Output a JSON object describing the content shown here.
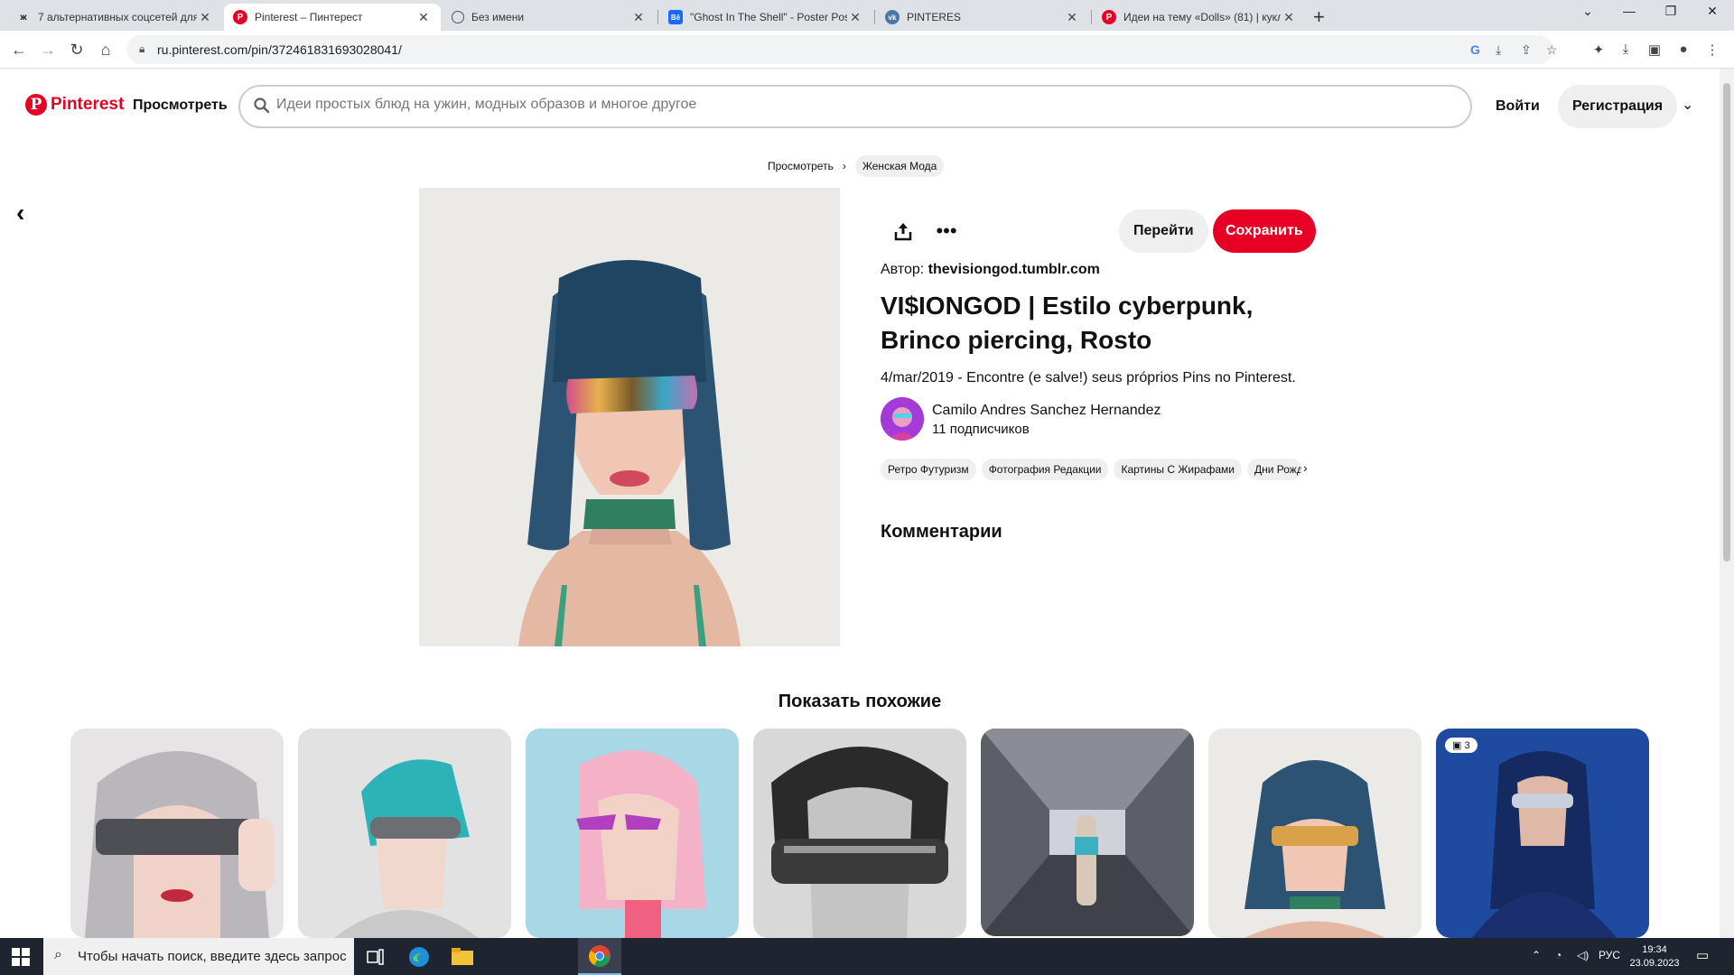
{
  "browser": {
    "tabs": [
      {
        "title": "7 альтернативных соцсетей для",
        "icon": "ж"
      },
      {
        "title": "Pinterest – Пинтерест",
        "icon": "P"
      },
      {
        "title": "Без имени",
        "icon": "globe"
      },
      {
        "title": "\"Ghost In The Shell\" - Poster Pos",
        "icon": "Bē"
      },
      {
        "title": "PINTERES",
        "icon": "vk"
      },
      {
        "title": "Идеи на тему «Dolls» (81) | кукл",
        "icon": "P"
      }
    ],
    "url": "ru.pinterest.com/pin/372461831693028041/"
  },
  "header": {
    "logo_text": "Pinterest",
    "explore": "Просмотреть",
    "search_placeholder": "Идеи простых блюд на ужин, модных образов и многое другое",
    "login": "Войти",
    "signup": "Регистрация"
  },
  "breadcrumb": {
    "root": "Просмотреть",
    "current": "Женская Мода"
  },
  "pin": {
    "goto_label": "Перейти",
    "save_label": "Сохранить",
    "author_label": "Автор:",
    "author_site": "thevisiongod.tumblr.com",
    "title": "VI$IONGOD | Estilo cyberpunk, Brinco piercing, Rosto",
    "description": "4/mar/2019 - Encontre (e salve!) seus próprios Pins no Pinterest.",
    "user_name": "Camilo Andres Sanchez Hernandez",
    "followers": "11 подписчиков",
    "tags": [
      "Ретро Футуризм",
      "Фотография Редакции",
      "Картины С Жирафами",
      "Дни Рождения"
    ],
    "comments_title": "Комментарии"
  },
  "more": {
    "title": "Показать похожие",
    "badge": "3"
  },
  "taskbar": {
    "search_text": "Чтобы начать поиск, введите здесь запрос",
    "lang": "РУС",
    "time": "19:34",
    "date": "23.09.2023"
  },
  "colors": {
    "brand": "#e60023",
    "hair": "#2c5472",
    "taskbar": "#1f2431"
  }
}
